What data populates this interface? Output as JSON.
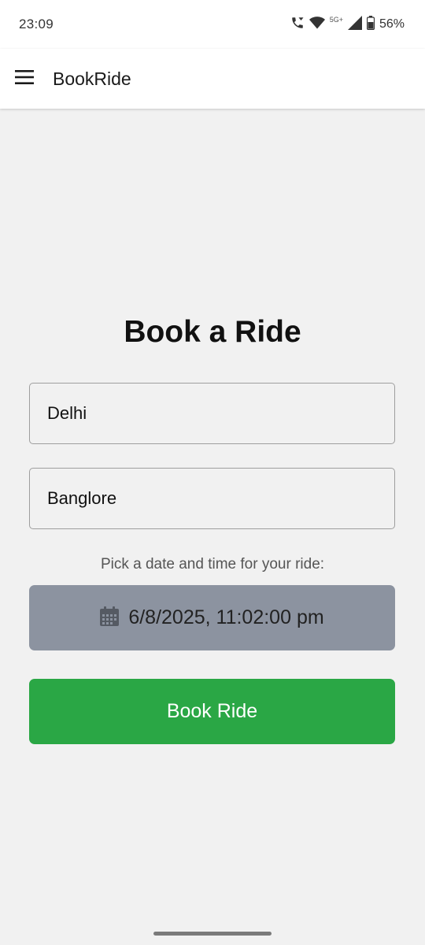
{
  "status_bar": {
    "time": "23:09",
    "network": "5G+",
    "battery": "56%"
  },
  "app_bar": {
    "title": "BookRide"
  },
  "form": {
    "heading": "Book a Ride",
    "from_value": "Delhi",
    "to_value": "Banglore",
    "date_prompt": "Pick a date and time for your ride:",
    "date_value": "6/8/2025, 11:02:00 pm",
    "submit_label": "Book Ride"
  },
  "colors": {
    "submit_button": "#2aa745",
    "date_button": "#8c93a0",
    "background": "#f1f1f1"
  },
  "icons": {
    "menu": "hamburger-menu-icon",
    "calendar": "calendar-icon"
  }
}
